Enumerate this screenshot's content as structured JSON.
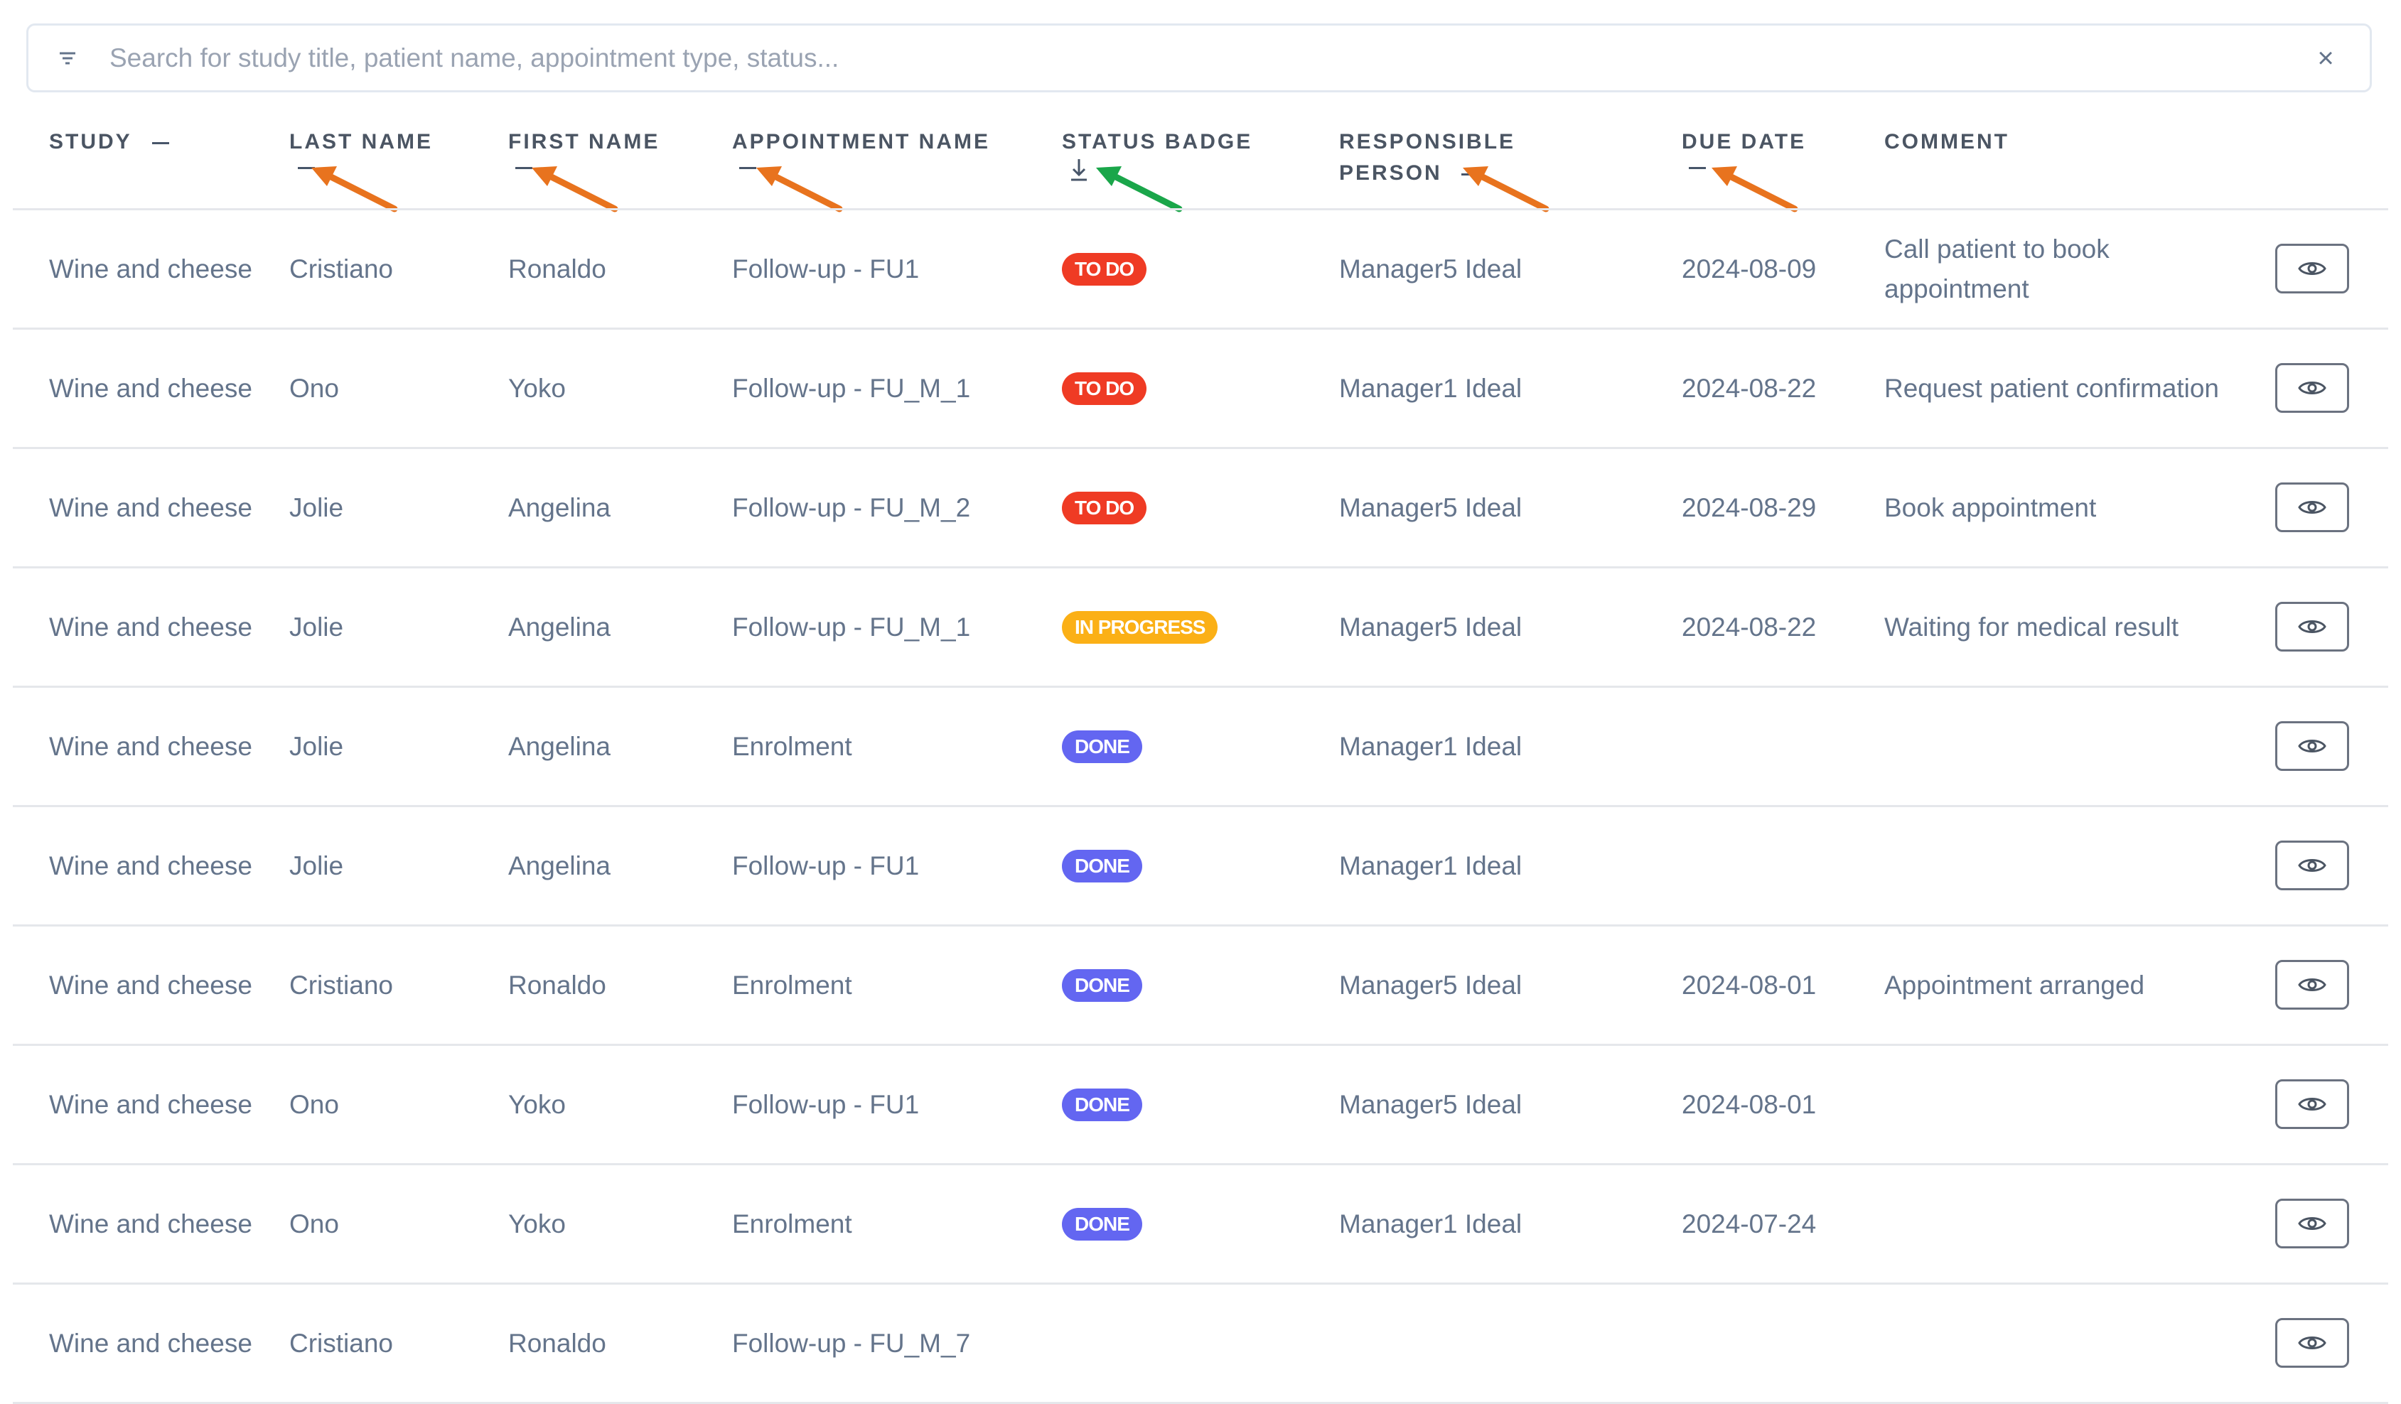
{
  "search": {
    "placeholder": "Search for study title, patient name, appointment type, status...",
    "clear_label": "×"
  },
  "header": {
    "study": "STUDY",
    "last_name": "LAST NAME",
    "first_name": "FIRST NAME",
    "appointment_name": "APPOINTMENT NAME",
    "status_badge": "STATUS BADGE",
    "responsible_line1": "RESPONSIBLE",
    "responsible_line2": "PERSON",
    "due_date": "DUE DATE",
    "comment": "COMMENT"
  },
  "colors": {
    "todo": "#ef3b24",
    "in_progress": "#fbb016",
    "done": "#6366f1",
    "annotation_orange": "#e8731e",
    "annotation_green": "#1aa64a"
  },
  "rows": [
    {
      "study": "Wine and cheese",
      "last_name": "Cristiano",
      "first_name": "Ronaldo",
      "appointment": "Follow-up - FU1",
      "status": "TO DO",
      "status_type": "todo",
      "responsible": "Manager5 Ideal",
      "due_date": "2024-08-09",
      "comment": "Call patient to book appointment"
    },
    {
      "study": "Wine and cheese",
      "last_name": "Ono",
      "first_name": "Yoko",
      "appointment": "Follow-up - FU_M_1",
      "status": "TO DO",
      "status_type": "todo",
      "responsible": "Manager1 Ideal",
      "due_date": "2024-08-22",
      "comment": "Request patient confirmation"
    },
    {
      "study": "Wine and cheese",
      "last_name": "Jolie",
      "first_name": "Angelina",
      "appointment": "Follow-up - FU_M_2",
      "status": "TO DO",
      "status_type": "todo",
      "responsible": "Manager5 Ideal",
      "due_date": "2024-08-29",
      "comment": "Book appointment"
    },
    {
      "study": "Wine and cheese",
      "last_name": "Jolie",
      "first_name": "Angelina",
      "appointment": "Follow-up - FU_M_1",
      "status": "IN PROGRESS",
      "status_type": "inprog",
      "responsible": "Manager5 Ideal",
      "due_date": "2024-08-22",
      "comment": "Waiting for medical result"
    },
    {
      "study": "Wine and cheese",
      "last_name": "Jolie",
      "first_name": "Angelina",
      "appointment": "Enrolment",
      "status": "DONE",
      "status_type": "done",
      "responsible": "Manager1 Ideal",
      "due_date": "",
      "comment": ""
    },
    {
      "study": "Wine and cheese",
      "last_name": "Jolie",
      "first_name": "Angelina",
      "appointment": "Follow-up - FU1",
      "status": "DONE",
      "status_type": "done",
      "responsible": "Manager1 Ideal",
      "due_date": "",
      "comment": ""
    },
    {
      "study": "Wine and cheese",
      "last_name": "Cristiano",
      "first_name": "Ronaldo",
      "appointment": "Enrolment",
      "status": "DONE",
      "status_type": "done",
      "responsible": "Manager5 Ideal",
      "due_date": "2024-08-01",
      "comment": "Appointment arranged"
    },
    {
      "study": "Wine and cheese",
      "last_name": "Ono",
      "first_name": "Yoko",
      "appointment": "Follow-up - FU1",
      "status": "DONE",
      "status_type": "done",
      "responsible": "Manager5 Ideal",
      "due_date": "2024-08-01",
      "comment": ""
    },
    {
      "study": "Wine and cheese",
      "last_name": "Ono",
      "first_name": "Yoko",
      "appointment": "Enrolment",
      "status": "DONE",
      "status_type": "done",
      "responsible": "Manager1 Ideal",
      "due_date": "2024-07-24",
      "comment": ""
    },
    {
      "study": "Wine and cheese",
      "last_name": "Cristiano",
      "first_name": "Ronaldo",
      "appointment": "Follow-up - FU_M_7",
      "status": "",
      "status_type": "",
      "responsible": "",
      "due_date": "",
      "comment": ""
    }
  ]
}
